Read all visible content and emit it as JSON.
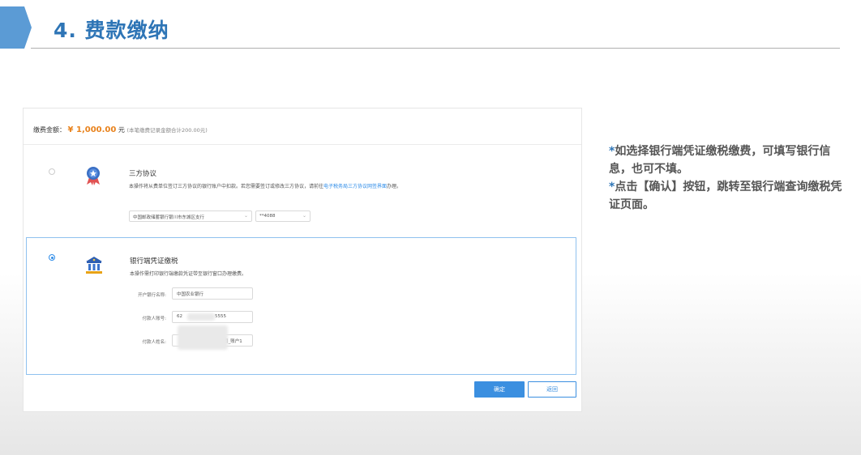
{
  "slide": {
    "title": "4. 费款缴纳",
    "accent_color": "#2e75b6"
  },
  "payment": {
    "amount_label": "缴费金额：",
    "amount_value": "¥ 1,000.00",
    "amount_unit": "元",
    "amount_note": "(本笔缴费记录金额合计200.00元)"
  },
  "option_three_party": {
    "icon": "award-badge-icon",
    "title": "三方协议",
    "desc_text": "本操作将从费单位签订三方协议的银行账户中扣款。若您需要签订或修改三方协议，请前往",
    "desc_link": "电子税务局三方协议网签界面",
    "desc_tail": "办理。",
    "bank_select": "中国邮政储蓄银行银川市东城区支行",
    "account_select": "**4088"
  },
  "option_bank_voucher": {
    "icon": "bank-building-icon",
    "title": "银行端凭证缴税",
    "desc": "本操作需打印银行端缴款凭证带至银行窗口办理缴费。",
    "fields": {
      "bank_name_label": "开户银行名称:",
      "bank_name_value": "中国农业银行",
      "account_label": "付款人账号:",
      "account_prefix": "62",
      "account_suffix": "5555",
      "name_label": "付款人姓名:",
      "name_value_visible": "司_账户1"
    }
  },
  "buttons": {
    "confirm": "确定",
    "back": "返回"
  },
  "notes": {
    "line1_star": "*",
    "line1": "如选择银行端凭证缴税缴费，可填写银行信息，也可不填。",
    "line2_star": "*",
    "line2": "点击【确认】按钮，跳转至银行端查询缴税凭证页面。"
  }
}
